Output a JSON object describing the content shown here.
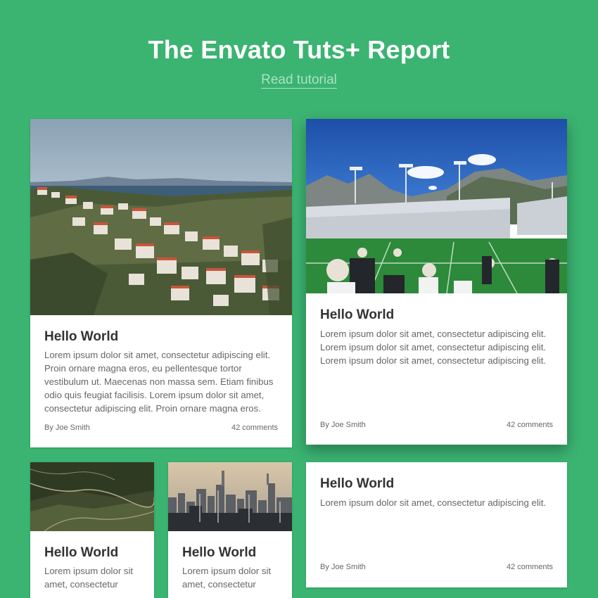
{
  "header": {
    "title": "The Envato Tuts+ Report",
    "link_label": "Read tutorial"
  },
  "cards": [
    {
      "image": "coastal-town-photo",
      "title": "Hello World",
      "body": "Lorem ipsum dolor sit amet, consectetur adipiscing elit. Proin ornare magna eros, eu pellentesque tortor vestibulum ut. Maecenas non massa sem. Etiam finibus odio quis feugiat facilisis. Lorem ipsum dolor sit amet, consectetur adipiscing elit. Proin ornare magna eros.",
      "author": "By Joe Smith",
      "comments": "42 comments"
    },
    {
      "image": "stadium-photo",
      "title": "Hello World",
      "body": "Lorem ipsum dolor sit amet, consectetur adipiscing elit. Lorem ipsum dolor sit amet, consectetur adipiscing elit. Lorem ipsum dolor sit amet, consectetur adipiscing elit.",
      "author": "By Joe Smith",
      "comments": "42 comments"
    },
    {
      "image": "aerial-landscape-photo",
      "title": "Hello World",
      "body": "Lorem ipsum dolor sit amet, consectetur"
    },
    {
      "image": "city-skyline-photo",
      "title": "Hello World",
      "body": "Lorem ipsum dolor sit amet, consectetur"
    },
    {
      "title": "Hello World",
      "body": "Lorem ipsum dolor sit amet, consectetur adipiscing elit.",
      "author": "By Joe Smith",
      "comments": "42 comments"
    }
  ]
}
